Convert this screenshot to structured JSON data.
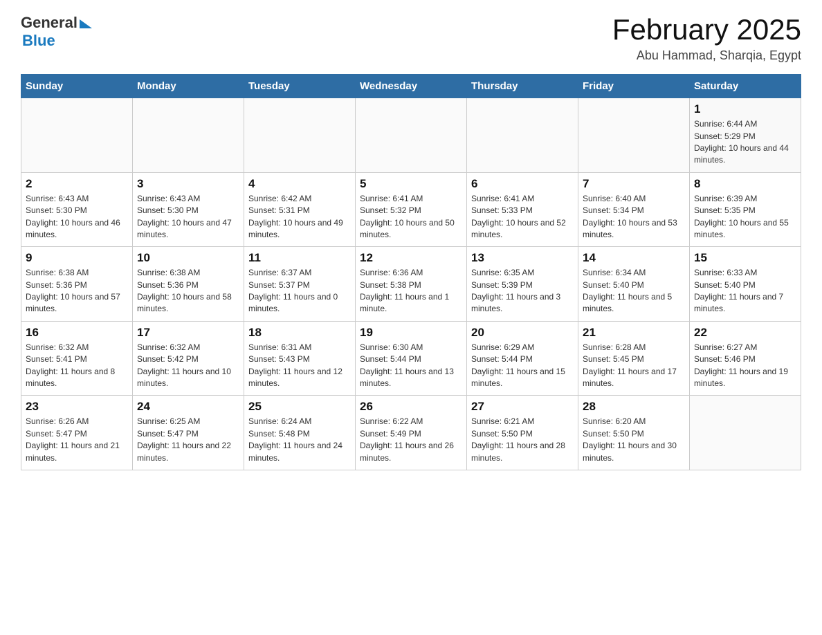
{
  "header": {
    "logo_general": "General",
    "logo_blue": "Blue",
    "month_title": "February 2025",
    "location": "Abu Hammad, Sharqia, Egypt"
  },
  "days_of_week": [
    "Sunday",
    "Monday",
    "Tuesday",
    "Wednesday",
    "Thursday",
    "Friday",
    "Saturday"
  ],
  "weeks": [
    [
      {
        "day": "",
        "sunrise": "",
        "sunset": "",
        "daylight": ""
      },
      {
        "day": "",
        "sunrise": "",
        "sunset": "",
        "daylight": ""
      },
      {
        "day": "",
        "sunrise": "",
        "sunset": "",
        "daylight": ""
      },
      {
        "day": "",
        "sunrise": "",
        "sunset": "",
        "daylight": ""
      },
      {
        "day": "",
        "sunrise": "",
        "sunset": "",
        "daylight": ""
      },
      {
        "day": "",
        "sunrise": "",
        "sunset": "",
        "daylight": ""
      },
      {
        "day": "1",
        "sunrise": "Sunrise: 6:44 AM",
        "sunset": "Sunset: 5:29 PM",
        "daylight": "Daylight: 10 hours and 44 minutes."
      }
    ],
    [
      {
        "day": "2",
        "sunrise": "Sunrise: 6:43 AM",
        "sunset": "Sunset: 5:30 PM",
        "daylight": "Daylight: 10 hours and 46 minutes."
      },
      {
        "day": "3",
        "sunrise": "Sunrise: 6:43 AM",
        "sunset": "Sunset: 5:30 PM",
        "daylight": "Daylight: 10 hours and 47 minutes."
      },
      {
        "day": "4",
        "sunrise": "Sunrise: 6:42 AM",
        "sunset": "Sunset: 5:31 PM",
        "daylight": "Daylight: 10 hours and 49 minutes."
      },
      {
        "day": "5",
        "sunrise": "Sunrise: 6:41 AM",
        "sunset": "Sunset: 5:32 PM",
        "daylight": "Daylight: 10 hours and 50 minutes."
      },
      {
        "day": "6",
        "sunrise": "Sunrise: 6:41 AM",
        "sunset": "Sunset: 5:33 PM",
        "daylight": "Daylight: 10 hours and 52 minutes."
      },
      {
        "day": "7",
        "sunrise": "Sunrise: 6:40 AM",
        "sunset": "Sunset: 5:34 PM",
        "daylight": "Daylight: 10 hours and 53 minutes."
      },
      {
        "day": "8",
        "sunrise": "Sunrise: 6:39 AM",
        "sunset": "Sunset: 5:35 PM",
        "daylight": "Daylight: 10 hours and 55 minutes."
      }
    ],
    [
      {
        "day": "9",
        "sunrise": "Sunrise: 6:38 AM",
        "sunset": "Sunset: 5:36 PM",
        "daylight": "Daylight: 10 hours and 57 minutes."
      },
      {
        "day": "10",
        "sunrise": "Sunrise: 6:38 AM",
        "sunset": "Sunset: 5:36 PM",
        "daylight": "Daylight: 10 hours and 58 minutes."
      },
      {
        "day": "11",
        "sunrise": "Sunrise: 6:37 AM",
        "sunset": "Sunset: 5:37 PM",
        "daylight": "Daylight: 11 hours and 0 minutes."
      },
      {
        "day": "12",
        "sunrise": "Sunrise: 6:36 AM",
        "sunset": "Sunset: 5:38 PM",
        "daylight": "Daylight: 11 hours and 1 minute."
      },
      {
        "day": "13",
        "sunrise": "Sunrise: 6:35 AM",
        "sunset": "Sunset: 5:39 PM",
        "daylight": "Daylight: 11 hours and 3 minutes."
      },
      {
        "day": "14",
        "sunrise": "Sunrise: 6:34 AM",
        "sunset": "Sunset: 5:40 PM",
        "daylight": "Daylight: 11 hours and 5 minutes."
      },
      {
        "day": "15",
        "sunrise": "Sunrise: 6:33 AM",
        "sunset": "Sunset: 5:40 PM",
        "daylight": "Daylight: 11 hours and 7 minutes."
      }
    ],
    [
      {
        "day": "16",
        "sunrise": "Sunrise: 6:32 AM",
        "sunset": "Sunset: 5:41 PM",
        "daylight": "Daylight: 11 hours and 8 minutes."
      },
      {
        "day": "17",
        "sunrise": "Sunrise: 6:32 AM",
        "sunset": "Sunset: 5:42 PM",
        "daylight": "Daylight: 11 hours and 10 minutes."
      },
      {
        "day": "18",
        "sunrise": "Sunrise: 6:31 AM",
        "sunset": "Sunset: 5:43 PM",
        "daylight": "Daylight: 11 hours and 12 minutes."
      },
      {
        "day": "19",
        "sunrise": "Sunrise: 6:30 AM",
        "sunset": "Sunset: 5:44 PM",
        "daylight": "Daylight: 11 hours and 13 minutes."
      },
      {
        "day": "20",
        "sunrise": "Sunrise: 6:29 AM",
        "sunset": "Sunset: 5:44 PM",
        "daylight": "Daylight: 11 hours and 15 minutes."
      },
      {
        "day": "21",
        "sunrise": "Sunrise: 6:28 AM",
        "sunset": "Sunset: 5:45 PM",
        "daylight": "Daylight: 11 hours and 17 minutes."
      },
      {
        "day": "22",
        "sunrise": "Sunrise: 6:27 AM",
        "sunset": "Sunset: 5:46 PM",
        "daylight": "Daylight: 11 hours and 19 minutes."
      }
    ],
    [
      {
        "day": "23",
        "sunrise": "Sunrise: 6:26 AM",
        "sunset": "Sunset: 5:47 PM",
        "daylight": "Daylight: 11 hours and 21 minutes."
      },
      {
        "day": "24",
        "sunrise": "Sunrise: 6:25 AM",
        "sunset": "Sunset: 5:47 PM",
        "daylight": "Daylight: 11 hours and 22 minutes."
      },
      {
        "day": "25",
        "sunrise": "Sunrise: 6:24 AM",
        "sunset": "Sunset: 5:48 PM",
        "daylight": "Daylight: 11 hours and 24 minutes."
      },
      {
        "day": "26",
        "sunrise": "Sunrise: 6:22 AM",
        "sunset": "Sunset: 5:49 PM",
        "daylight": "Daylight: 11 hours and 26 minutes."
      },
      {
        "day": "27",
        "sunrise": "Sunrise: 6:21 AM",
        "sunset": "Sunset: 5:50 PM",
        "daylight": "Daylight: 11 hours and 28 minutes."
      },
      {
        "day": "28",
        "sunrise": "Sunrise: 6:20 AM",
        "sunset": "Sunset: 5:50 PM",
        "daylight": "Daylight: 11 hours and 30 minutes."
      },
      {
        "day": "",
        "sunrise": "",
        "sunset": "",
        "daylight": ""
      }
    ]
  ]
}
